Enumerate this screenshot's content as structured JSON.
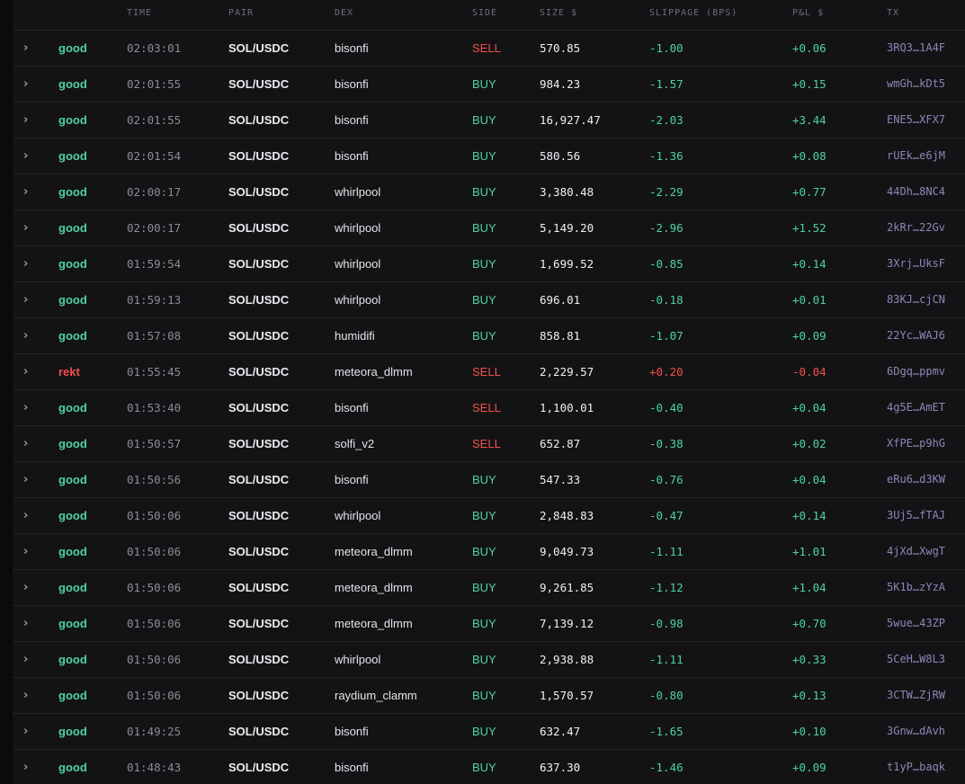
{
  "colors": {
    "good": "#4fd1a5",
    "rekt": "#f2504b",
    "buy": "#4fd1a5",
    "sell": "#f2504b",
    "negative_slippage": "#4fd1a5",
    "positive_slippage": "#f2504b",
    "positive_pnl": "#4fd1a5",
    "negative_pnl": "#f2504b",
    "tx_link": "#8e86b8"
  },
  "icons": {
    "row_expand": "chevron-right-icon"
  },
  "header": {
    "time": "TIME",
    "pair": "PAIR",
    "dex": "DEX",
    "side": "SIDE",
    "size": "SIZE $",
    "slippage": "SLIPPAGE (BPS)",
    "pnl": "P&L $",
    "tx": "TX"
  },
  "rows": [
    {
      "status": "good",
      "time": "02:03:01",
      "pair": "SOL/USDC",
      "dex": "bisonfi",
      "side": "SELL",
      "size": "570.85",
      "slippage": "-1.00",
      "pnl": "+0.06",
      "tx": "3RQ3…1A4F"
    },
    {
      "status": "good",
      "time": "02:01:55",
      "pair": "SOL/USDC",
      "dex": "bisonfi",
      "side": "BUY",
      "size": "984.23",
      "slippage": "-1.57",
      "pnl": "+0.15",
      "tx": "wmGh…kDt5"
    },
    {
      "status": "good",
      "time": "02:01:55",
      "pair": "SOL/USDC",
      "dex": "bisonfi",
      "side": "BUY",
      "size": "16,927.47",
      "slippage": "-2.03",
      "pnl": "+3.44",
      "tx": "ENE5…XFX7"
    },
    {
      "status": "good",
      "time": "02:01:54",
      "pair": "SOL/USDC",
      "dex": "bisonfi",
      "side": "BUY",
      "size": "580.56",
      "slippage": "-1.36",
      "pnl": "+0.08",
      "tx": "rUEk…e6jM"
    },
    {
      "status": "good",
      "time": "02:00:17",
      "pair": "SOL/USDC",
      "dex": "whirlpool",
      "side": "BUY",
      "size": "3,380.48",
      "slippage": "-2.29",
      "pnl": "+0.77",
      "tx": "44Dh…8NC4"
    },
    {
      "status": "good",
      "time": "02:00:17",
      "pair": "SOL/USDC",
      "dex": "whirlpool",
      "side": "BUY",
      "size": "5,149.20",
      "slippage": "-2.96",
      "pnl": "+1.52",
      "tx": "2kRr…22Gv"
    },
    {
      "status": "good",
      "time": "01:59:54",
      "pair": "SOL/USDC",
      "dex": "whirlpool",
      "side": "BUY",
      "size": "1,699.52",
      "slippage": "-0.85",
      "pnl": "+0.14",
      "tx": "3Xrj…UksF"
    },
    {
      "status": "good",
      "time": "01:59:13",
      "pair": "SOL/USDC",
      "dex": "whirlpool",
      "side": "BUY",
      "size": "696.01",
      "slippage": "-0.18",
      "pnl": "+0.01",
      "tx": "83KJ…cjCN"
    },
    {
      "status": "good",
      "time": "01:57:08",
      "pair": "SOL/USDC",
      "dex": "humidifi",
      "side": "BUY",
      "size": "858.81",
      "slippage": "-1.07",
      "pnl": "+0.09",
      "tx": "22Yc…WAJ6"
    },
    {
      "status": "rekt",
      "time": "01:55:45",
      "pair": "SOL/USDC",
      "dex": "meteora_dlmm",
      "side": "SELL",
      "size": "2,229.57",
      "slippage": "+0.20",
      "pnl": "-0.04",
      "tx": "6Dgq…ppmv"
    },
    {
      "status": "good",
      "time": "01:53:40",
      "pair": "SOL/USDC",
      "dex": "bisonfi",
      "side": "SELL",
      "size": "1,100.01",
      "slippage": "-0.40",
      "pnl": "+0.04",
      "tx": "4g5E…AmET"
    },
    {
      "status": "good",
      "time": "01:50:57",
      "pair": "SOL/USDC",
      "dex": "solfi_v2",
      "side": "SELL",
      "size": "652.87",
      "slippage": "-0.38",
      "pnl": "+0.02",
      "tx": "XfPE…p9hG"
    },
    {
      "status": "good",
      "time": "01:50:56",
      "pair": "SOL/USDC",
      "dex": "bisonfi",
      "side": "BUY",
      "size": "547.33",
      "slippage": "-0.76",
      "pnl": "+0.04",
      "tx": "eRu6…d3KW"
    },
    {
      "status": "good",
      "time": "01:50:06",
      "pair": "SOL/USDC",
      "dex": "whirlpool",
      "side": "BUY",
      "size": "2,848.83",
      "slippage": "-0.47",
      "pnl": "+0.14",
      "tx": "3Uj5…fTAJ"
    },
    {
      "status": "good",
      "time": "01:50:06",
      "pair": "SOL/USDC",
      "dex": "meteora_dlmm",
      "side": "BUY",
      "size": "9,049.73",
      "slippage": "-1.11",
      "pnl": "+1.01",
      "tx": "4jXd…XwgT"
    },
    {
      "status": "good",
      "time": "01:50:06",
      "pair": "SOL/USDC",
      "dex": "meteora_dlmm",
      "side": "BUY",
      "size": "9,261.85",
      "slippage": "-1.12",
      "pnl": "+1.04",
      "tx": "5K1b…zYzA"
    },
    {
      "status": "good",
      "time": "01:50:06",
      "pair": "SOL/USDC",
      "dex": "meteora_dlmm",
      "side": "BUY",
      "size": "7,139.12",
      "slippage": "-0.98",
      "pnl": "+0.70",
      "tx": "5wue…43ZP"
    },
    {
      "status": "good",
      "time": "01:50:06",
      "pair": "SOL/USDC",
      "dex": "whirlpool",
      "side": "BUY",
      "size": "2,938.88",
      "slippage": "-1.11",
      "pnl": "+0.33",
      "tx": "5CeH…W8L3"
    },
    {
      "status": "good",
      "time": "01:50:06",
      "pair": "SOL/USDC",
      "dex": "raydium_clamm",
      "side": "BUY",
      "size": "1,570.57",
      "slippage": "-0.80",
      "pnl": "+0.13",
      "tx": "3CTW…ZjRW"
    },
    {
      "status": "good",
      "time": "01:49:25",
      "pair": "SOL/USDC",
      "dex": "bisonfi",
      "side": "BUY",
      "size": "632.47",
      "slippage": "-1.65",
      "pnl": "+0.10",
      "tx": "3Gnw…dAvh"
    },
    {
      "status": "good",
      "time": "01:48:43",
      "pair": "SOL/USDC",
      "dex": "bisonfi",
      "side": "BUY",
      "size": "637.30",
      "slippage": "-1.46",
      "pnl": "+0.09",
      "tx": "t1yP…baqk"
    }
  ]
}
